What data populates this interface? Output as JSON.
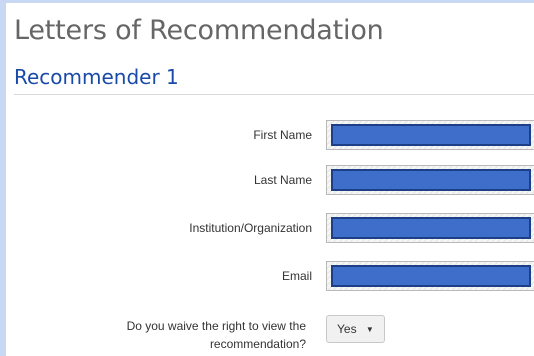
{
  "page": {
    "title": "Letters of Recommendation"
  },
  "section": {
    "title": "Recommender 1"
  },
  "form": {
    "fields": [
      {
        "label": "First Name",
        "value": ""
      },
      {
        "label": "Last Name",
        "value": ""
      },
      {
        "label": "Institution/Organization",
        "value": ""
      },
      {
        "label": "Email",
        "value": ""
      }
    ],
    "waiver": {
      "label": "Do you waive the right to view the recommendation?",
      "selected": "Yes",
      "icon": "caret-down-icon"
    }
  },
  "colors": {
    "title": "#666666",
    "section_title": "#1a4aa8",
    "redaction_fill": "#3e6ec9",
    "redaction_border": "#1d3f86"
  }
}
